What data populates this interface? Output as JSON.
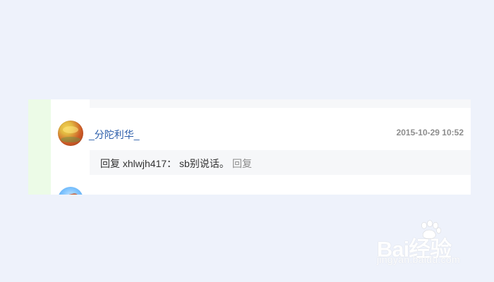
{
  "comment": {
    "username": "_分陀利华_",
    "timestamp": "2015-10-29 10:52",
    "reply_text": "回复 xhlwjh417： sb别说话。",
    "reply_action": "回复"
  },
  "watermark": {
    "brand": "Bai经验",
    "url": "jingyan.baidu.com"
  },
  "icons": {
    "avatar": "avatar-icon",
    "next_avatar": "avatar-icon",
    "watermark_logo": "paw-icon"
  }
}
